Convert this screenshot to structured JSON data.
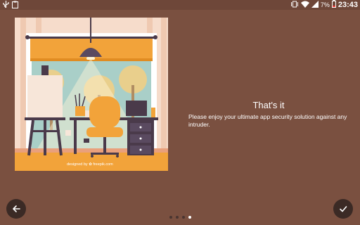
{
  "status_bar": {
    "battery_level": "7%",
    "time": "23:43",
    "icons": [
      "usb-icon",
      "clipboard-icon",
      "vibrate-icon",
      "wifi-icon",
      "signal-icon",
      "battery-icon"
    ]
  },
  "illustration": {
    "credit": "designed by ✿ freepik.com"
  },
  "content": {
    "title": "That's it",
    "message": "Please enjoy your ultimate app security solution against any intruder."
  },
  "navigation": {
    "back_icon": "arrow-left-icon",
    "done_icon": "check-icon"
  },
  "pager": {
    "total": 4,
    "current": 4
  },
  "colors": {
    "background": "#7a5040",
    "status_bar": "#6e4739",
    "nav_button": "#3b2a25",
    "accent_orange": "#f2a33a"
  }
}
